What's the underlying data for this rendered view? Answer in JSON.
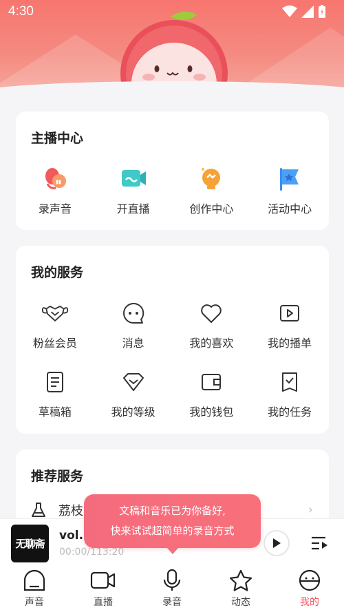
{
  "status_bar": {
    "time": "4:30"
  },
  "anchor_center": {
    "title": "主播中心",
    "items": [
      {
        "label": "录声音",
        "icon": "record-voice-icon"
      },
      {
        "label": "开直播",
        "icon": "live-camera-icon"
      },
      {
        "label": "创作中心",
        "icon": "creation-lightbulb-icon"
      },
      {
        "label": "活动中心",
        "icon": "event-flag-icon"
      }
    ]
  },
  "my_services": {
    "title": "我的服务",
    "items": [
      {
        "label": "粉丝会员",
        "icon": "fan-membership-icon"
      },
      {
        "label": "消息",
        "icon": "message-icon"
      },
      {
        "label": "我的喜欢",
        "icon": "heart-icon"
      },
      {
        "label": "我的播单",
        "icon": "playlist-icon"
      },
      {
        "label": "草稿箱",
        "icon": "drafts-icon"
      },
      {
        "label": "我的等级",
        "icon": "level-diamond-icon"
      },
      {
        "label": "我的钱包",
        "icon": "wallet-icon"
      },
      {
        "label": "我的任务",
        "icon": "task-icon"
      }
    ]
  },
  "recommended": {
    "title": "推荐服务",
    "row_label": "荔枝",
    "icon": "flask-icon"
  },
  "player": {
    "cover_text": "无聊斋",
    "title": "vol.5",
    "time": "00:00/113:20"
  },
  "tooltip": {
    "line1": "文稿和音乐已为你备好,",
    "line2": "快来试试超简单的录音方式"
  },
  "nav": {
    "items": [
      {
        "label": "声音",
        "icon": "sound-icon",
        "active": false
      },
      {
        "label": "直播",
        "icon": "live-icon",
        "active": false
      },
      {
        "label": "录音",
        "icon": "microphone-icon",
        "active": false
      },
      {
        "label": "动态",
        "icon": "star-icon",
        "active": false
      },
      {
        "label": "我的",
        "icon": "profile-icon",
        "active": true
      }
    ]
  },
  "colors": {
    "accent": "#f2545e",
    "header": "#f7766f"
  }
}
